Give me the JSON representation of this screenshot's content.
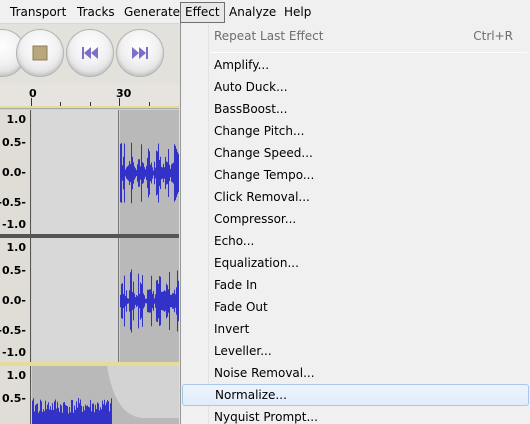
{
  "menubar": {
    "items": [
      {
        "label": "Transport"
      },
      {
        "label": "Tracks"
      },
      {
        "label": "Generate"
      },
      {
        "label": "Effect"
      },
      {
        "label": "Analyze"
      },
      {
        "label": "Help"
      }
    ]
  },
  "ruler": {
    "labels": [
      "0",
      "30"
    ]
  },
  "tracks": {
    "scale_labels": [
      "1.0",
      "0.5-",
      "0.0-",
      "-0.5-",
      "-1.0"
    ],
    "partial_scale_labels": [
      "1.0",
      "0.5-"
    ]
  },
  "effect_menu": {
    "repeat": {
      "label": "Repeat Last Effect",
      "shortcut": "Ctrl+R"
    },
    "items": [
      "Amplify...",
      "Auto Duck...",
      "BassBoost...",
      "Change Pitch...",
      "Change Speed...",
      "Change Tempo...",
      "Click Removal...",
      "Compressor...",
      "Echo...",
      "Equalization...",
      "Fade In",
      "Fade Out",
      "Invert",
      "Leveller...",
      "Noise Removal...",
      "Normalize...",
      "Nyquist Prompt..."
    ],
    "highlighted": "Normalize..."
  },
  "colors": {
    "waveform": "#3232c8",
    "menu_highlight": "#e1ecfb"
  },
  "icons": [
    "stop-icon",
    "skip-to-start-icon",
    "skip-to-end-icon"
  ]
}
